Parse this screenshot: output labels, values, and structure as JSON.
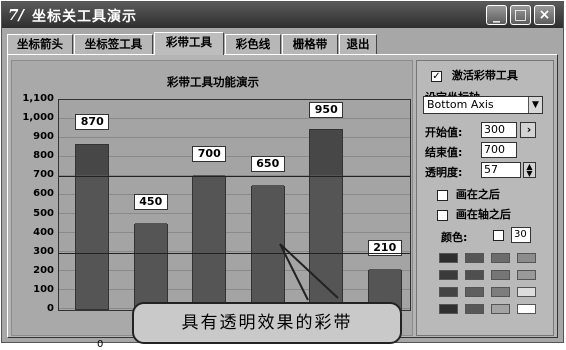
{
  "window": {
    "icon_text": "7/",
    "title": "坐标关工具演示",
    "buttons": [
      "_",
      "□",
      "×"
    ]
  },
  "tabs": [
    {
      "label": "坐标箭头",
      "active": false
    },
    {
      "label": "坐标签工具",
      "active": false
    },
    {
      "label": "彩带工具",
      "active": true
    },
    {
      "label": "彩色线",
      "active": false
    },
    {
      "label": "栅格带",
      "active": false
    },
    {
      "label": "退出",
      "active": false
    }
  ],
  "chart_data": {
    "type": "bar",
    "title": "彩带工具功能演示",
    "categories": [
      "0",
      "",
      "",
      "",
      "",
      ""
    ],
    "values": [
      870,
      450,
      700,
      650,
      950,
      210
    ],
    "value_labels": [
      "870",
      "450",
      "700",
      "650",
      "950",
      "210"
    ],
    "ylim": [
      0,
      1100
    ],
    "yticks": [
      "0",
      "100",
      "200",
      "300",
      "400",
      "500",
      "600",
      "700",
      "800",
      "900",
      "1,000",
      "1,100"
    ],
    "band": {
      "from": 300,
      "to": 700
    },
    "grid": true
  },
  "annotation": "具有透明效果的彩带",
  "settings": {
    "enable_label": "激活彩带工具",
    "enable_checked": true,
    "axis_label": "设定坐标轴",
    "axis_value": "Bottom Axis",
    "start_label": "开始值:",
    "start_value": "300",
    "end_label": "结束值:",
    "end_value": "700",
    "transparency_label": "透明度:",
    "transparency_value": "57",
    "draw_after_label": "画在之后",
    "draw_after_checked": false,
    "draw_on_axis_label": "画在轴之后",
    "draw_on_axis_checked": false,
    "color_label": "颜色:",
    "color_value": "30",
    "swatches": [
      "#2e2e2e",
      "#565656",
      "#6c6c6c",
      "#8c8c8c",
      "#3a3a3a",
      "#4f4f4f",
      "#767676",
      "#999999",
      "#444444",
      "#5f5f5f",
      "#7d7d7d",
      "#dddddd",
      "#303030",
      "#585858",
      "#a3a3a3",
      "#ffffff"
    ]
  }
}
